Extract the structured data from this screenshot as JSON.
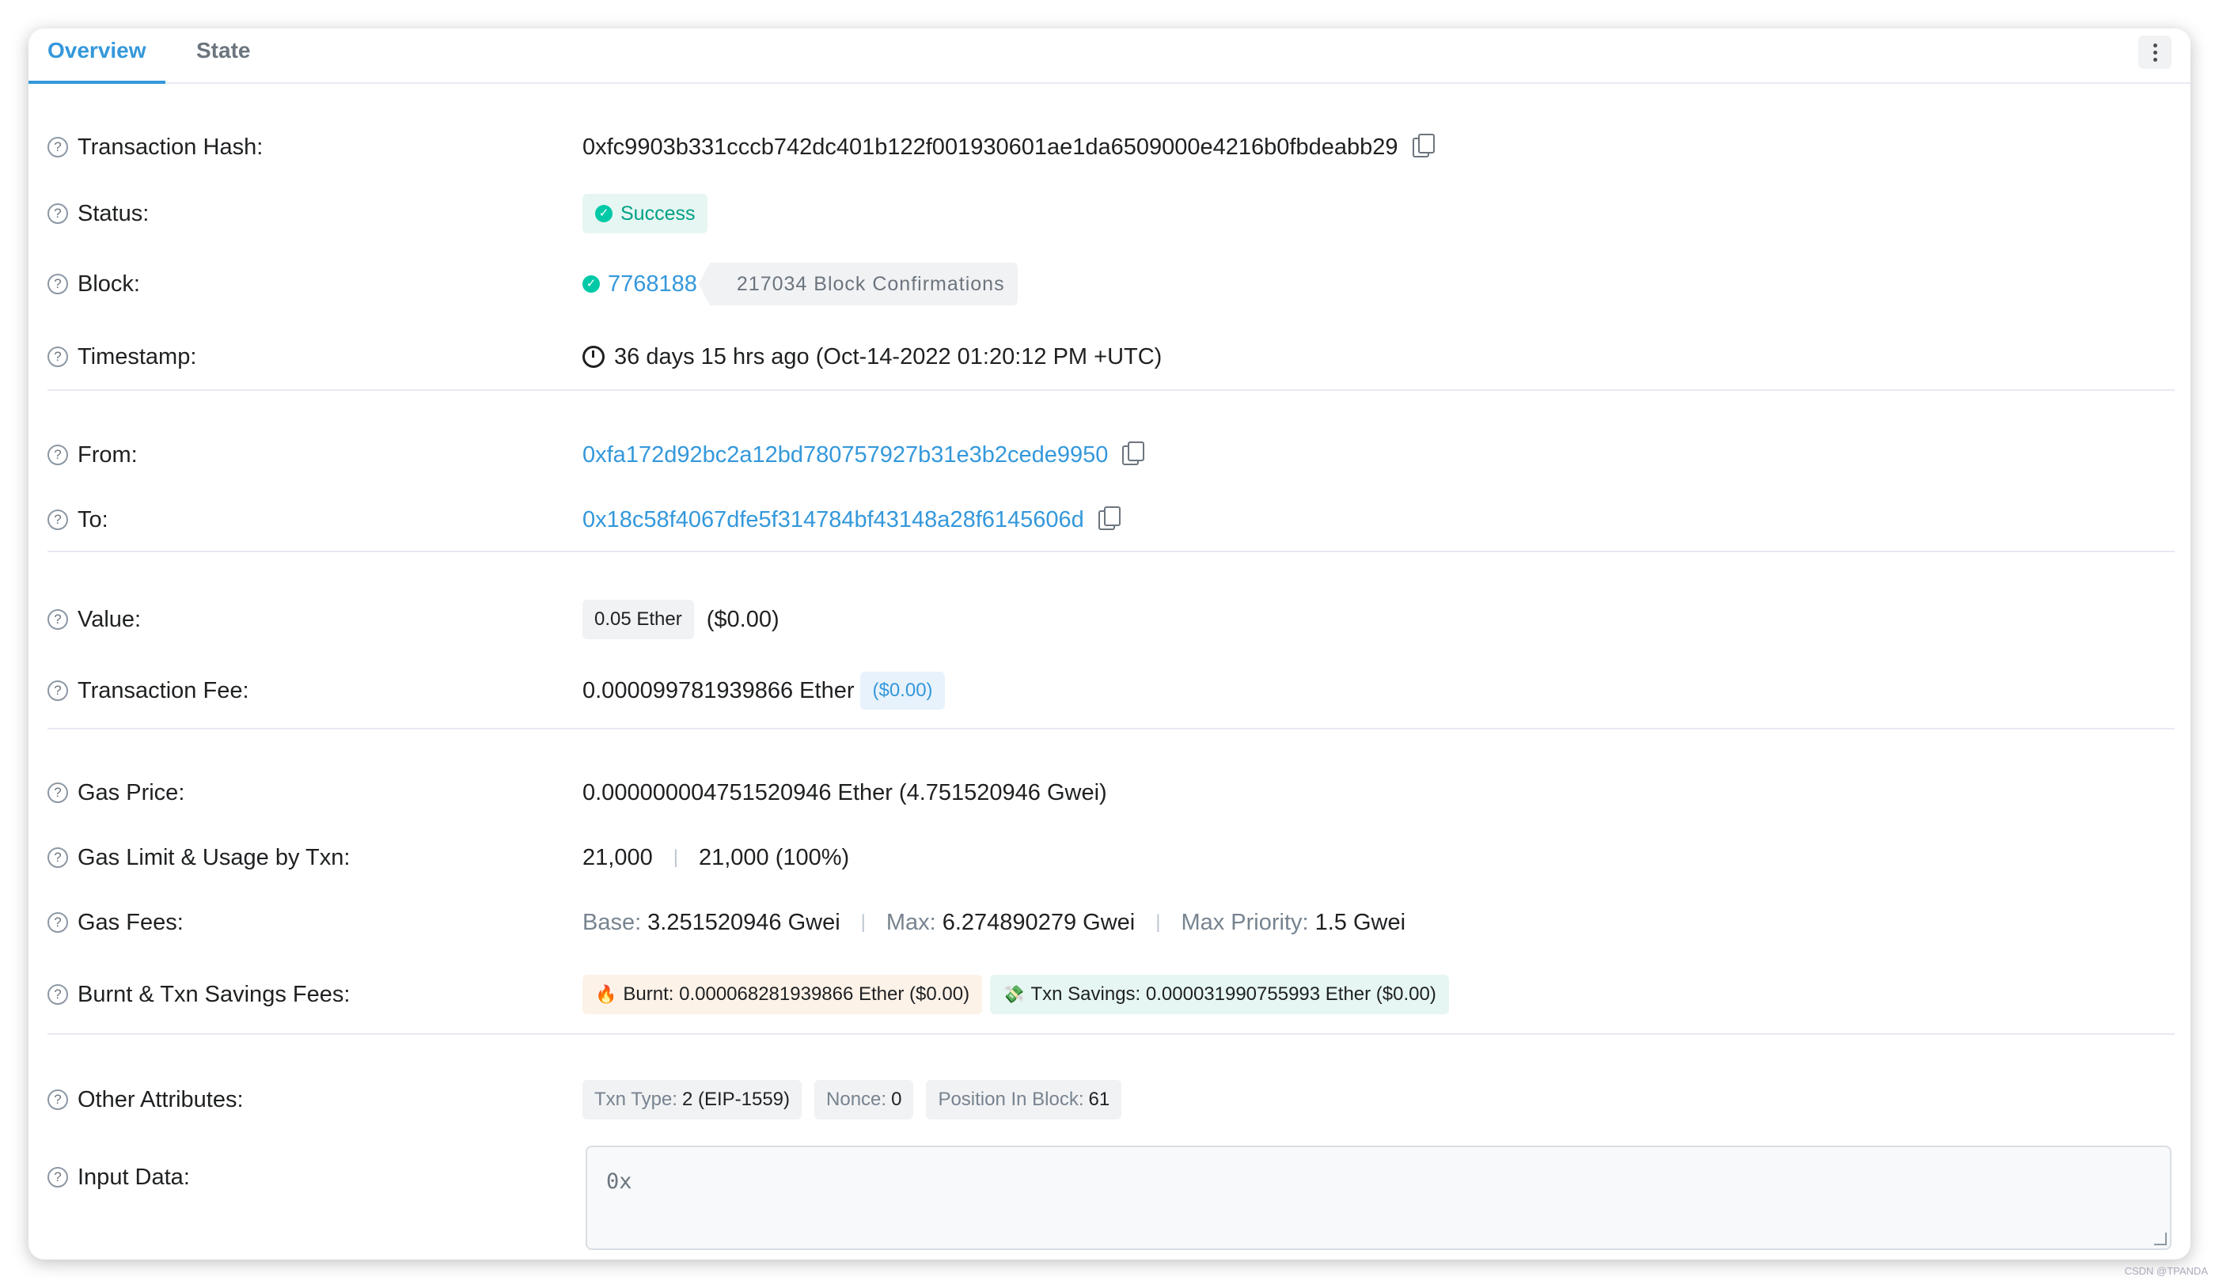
{
  "tabs": {
    "overview": "Overview",
    "state": "State"
  },
  "rows": {
    "tx_hash": {
      "label": "Transaction Hash:",
      "value": "0xfc9903b331cccb742dc401b122f001930601ae1da6509000e4216b0fbdeabb29"
    },
    "status": {
      "label": "Status:",
      "value": "Success"
    },
    "block": {
      "label": "Block:",
      "number": "7768188",
      "confirmations": "217034 Block Confirmations"
    },
    "timestamp": {
      "label": "Timestamp:",
      "value": "36 days 15 hrs ago (Oct-14-2022 01:20:12 PM +UTC)"
    },
    "from": {
      "label": "From:",
      "value": "0xfa172d92bc2a12bd780757927b31e3b2cede9950"
    },
    "to": {
      "label": "To:",
      "value": "0x18c58f4067dfe5f314784bf43148a28f6145606d"
    },
    "value": {
      "label": "Value:",
      "amount": "0.05 Ether",
      "usd": "($0.00)"
    },
    "tx_fee": {
      "label": "Transaction Fee:",
      "amount": "0.000099781939866 Ether",
      "usd": "($0.00)"
    },
    "gas_price": {
      "label": "Gas Price:",
      "value": "0.000000004751520946 Ether (4.751520946 Gwei)"
    },
    "gas_limit": {
      "label": "Gas Limit & Usage by Txn:",
      "limit": "21,000",
      "usage": "21,000 (100%)"
    },
    "gas_fees": {
      "label": "Gas Fees:",
      "base_label": "Base:",
      "base": "3.251520946 Gwei",
      "max_label": "Max:",
      "max": "6.274890279 Gwei",
      "priority_label": "Max Priority:",
      "priority": "1.5 Gwei"
    },
    "burnt": {
      "label": "Burnt & Txn Savings Fees:",
      "burnt_text": "Burnt: 0.000068281939866 Ether ($0.00)",
      "savings_text": "Txn Savings: 0.000031990755993 Ether ($0.00)"
    },
    "other": {
      "label": "Other Attributes:",
      "type_label": "Txn Type:",
      "type": "2 (EIP-1559)",
      "nonce_label": "Nonce:",
      "nonce": "0",
      "pos_label": "Position In Block:",
      "pos": "61"
    },
    "input": {
      "label": "Input Data:",
      "value": "0x"
    }
  },
  "icons": {
    "help": "?",
    "check": "✓",
    "fire": "🔥",
    "money": "💸"
  },
  "watermark": "CSDN @TPANDA",
  "colors": {
    "accent": "#3498db",
    "success": "#00c9a7",
    "text": "#1e2022",
    "muted": "#77838f"
  }
}
